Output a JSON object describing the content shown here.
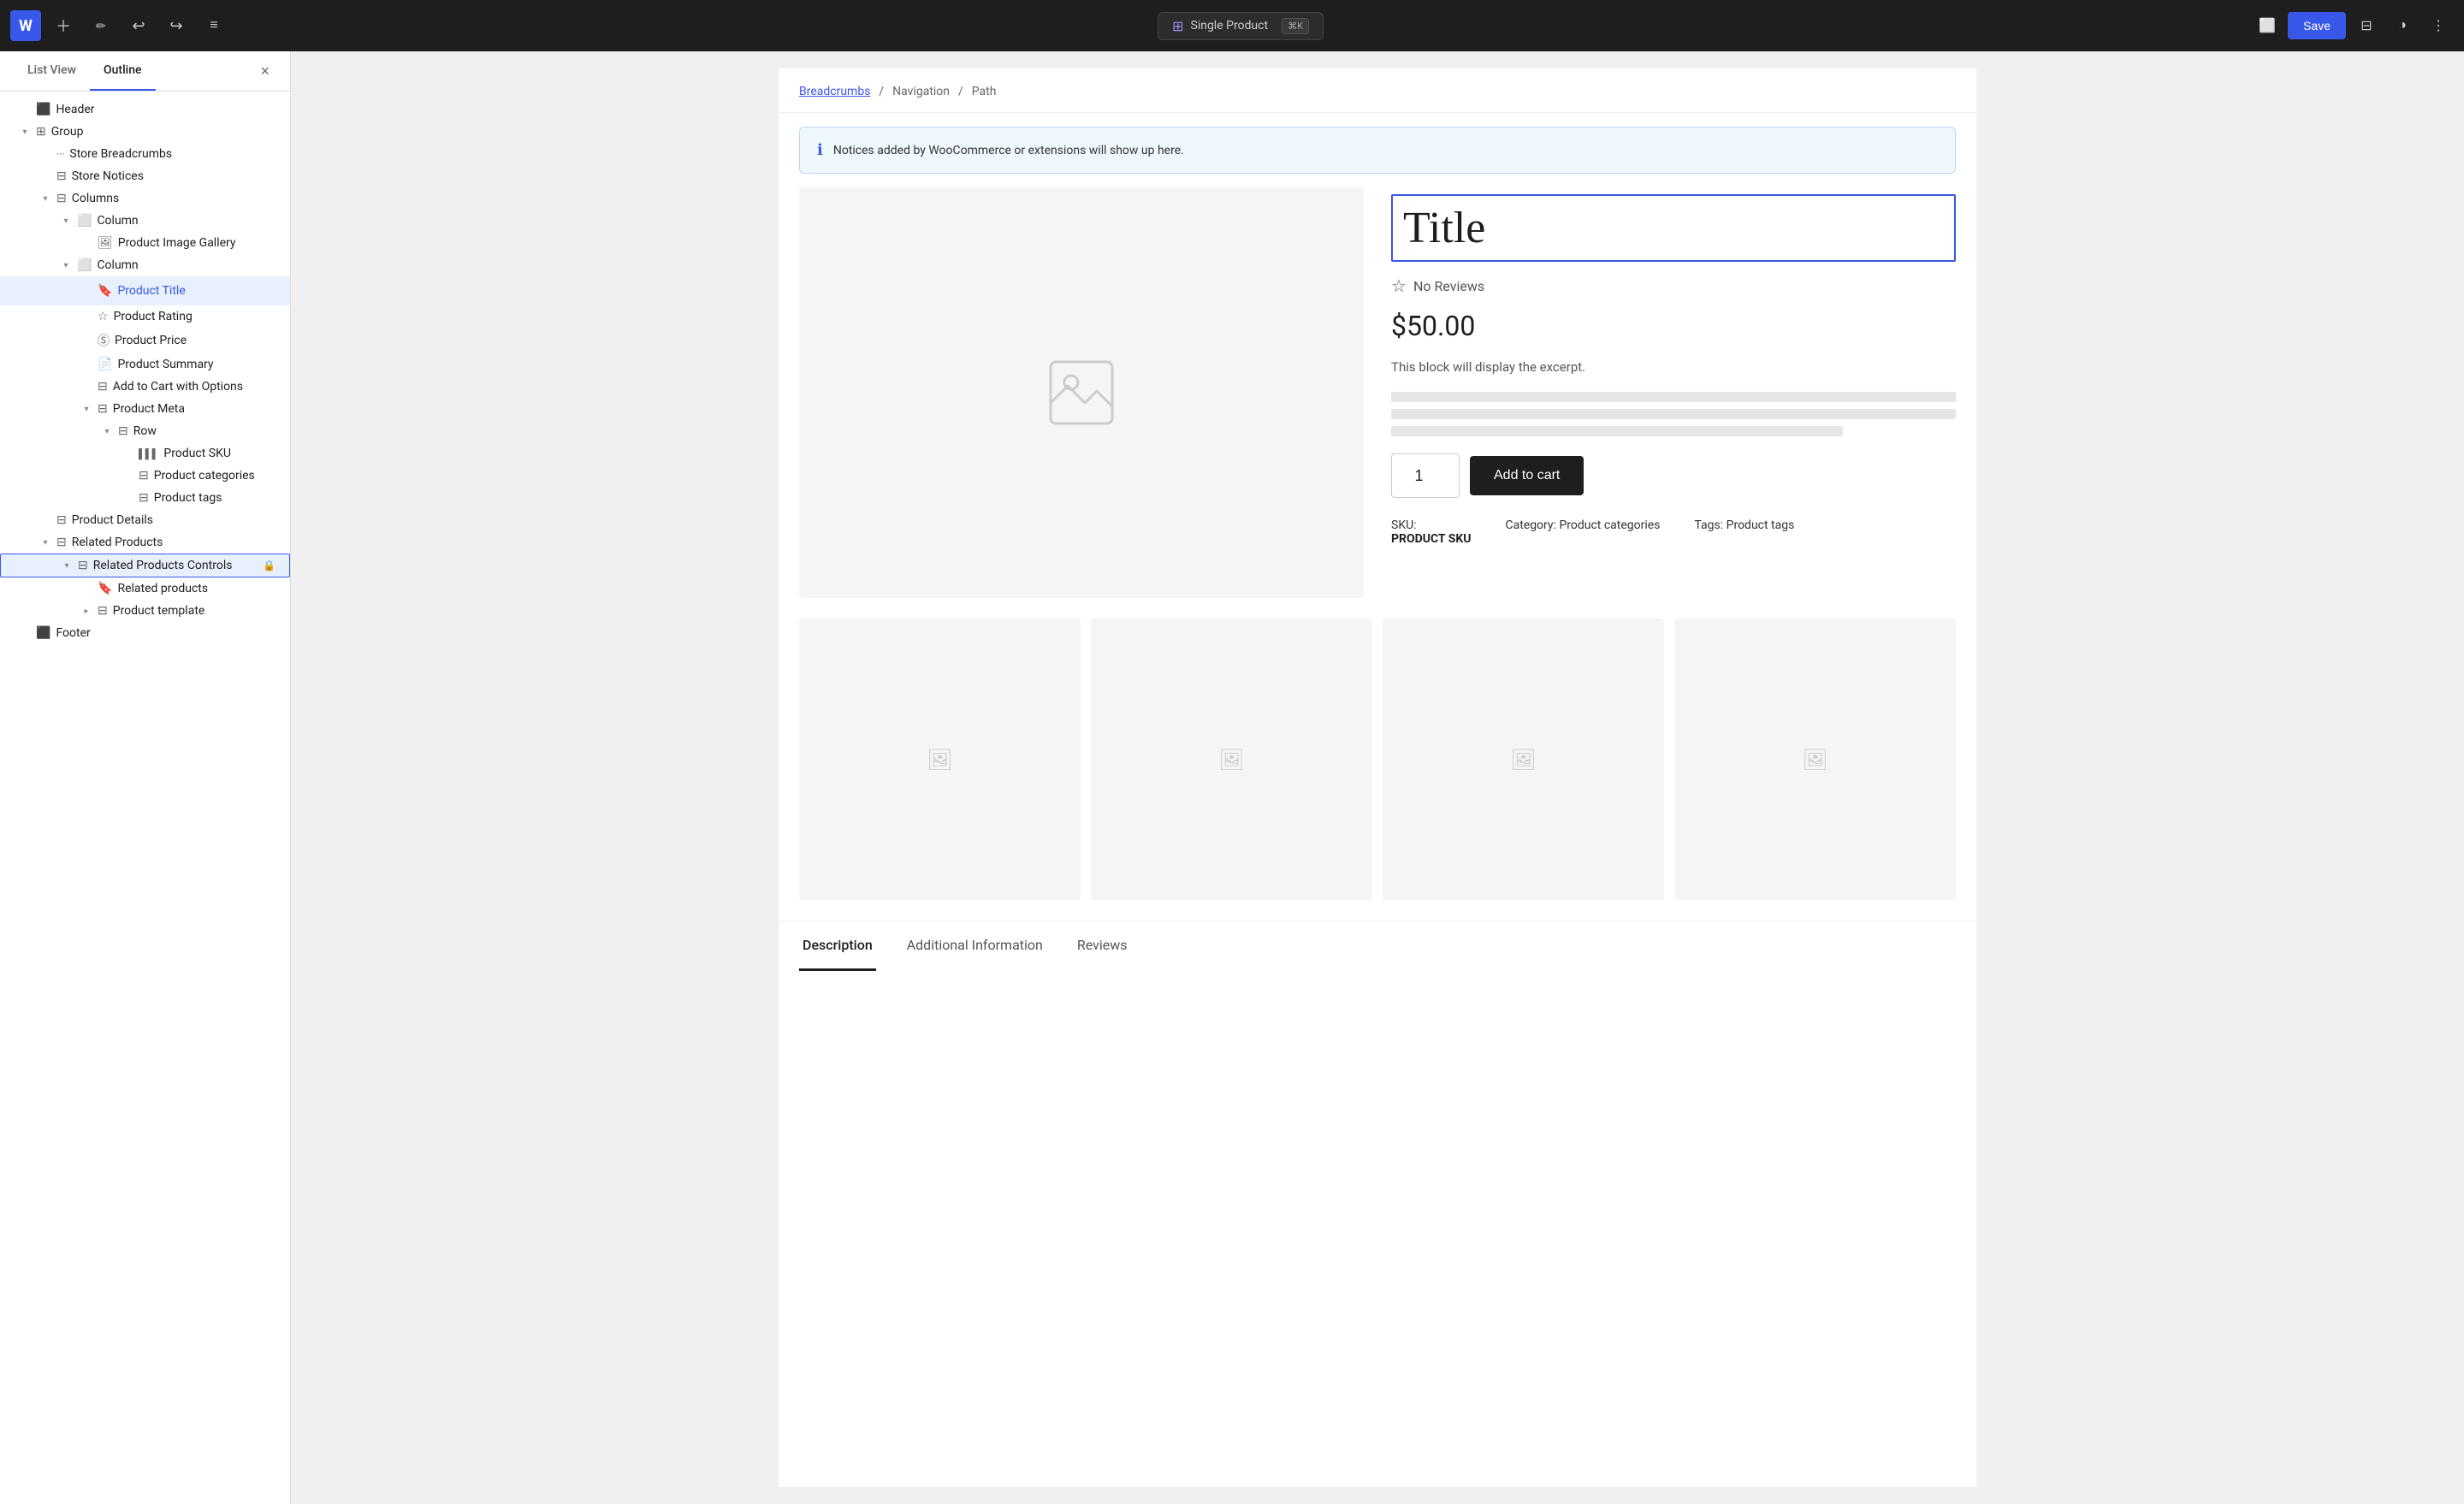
{
  "toolbar": {
    "wp_logo": "W",
    "add_label": "+",
    "edit_label": "✏",
    "undo_label": "↩",
    "redo_label": "↪",
    "list_view_label": "≡",
    "save_label": "Save",
    "template_name": "Single Product",
    "shortcut": "⌘K",
    "responsive_icon": "□",
    "style_icon": "◑",
    "more_icon": "⋮"
  },
  "sidebar": {
    "tab_list_view": "List View",
    "tab_outline": "Outline",
    "close_label": "×",
    "items": [
      {
        "id": "header",
        "label": "Header",
        "icon": "purple-block",
        "depth": 0,
        "toggle": ""
      },
      {
        "id": "group",
        "label": "Group",
        "icon": "grid",
        "depth": 0,
        "toggle": "▾"
      },
      {
        "id": "store-breadcrumbs",
        "label": "Store Breadcrumbs",
        "icon": "dots",
        "depth": 1,
        "toggle": ""
      },
      {
        "id": "store-notices",
        "label": "Store Notices",
        "icon": "table",
        "depth": 1,
        "toggle": ""
      },
      {
        "id": "columns",
        "label": "Columns",
        "icon": "columns",
        "depth": 1,
        "toggle": "▾"
      },
      {
        "id": "column-1",
        "label": "Column",
        "icon": "column",
        "depth": 2,
        "toggle": "▾"
      },
      {
        "id": "product-image-gallery",
        "label": "Product Image Gallery",
        "icon": "image",
        "depth": 3,
        "toggle": ""
      },
      {
        "id": "column-2",
        "label": "Column",
        "icon": "column",
        "depth": 2,
        "toggle": "▾"
      },
      {
        "id": "product-title",
        "label": "Product Title",
        "icon": "bookmark-blue",
        "depth": 3,
        "toggle": "",
        "selected": true
      },
      {
        "id": "product-rating",
        "label": "Product Rating",
        "icon": "star",
        "depth": 3,
        "toggle": ""
      },
      {
        "id": "product-price",
        "label": "Product Price",
        "icon": "circle-dollar",
        "depth": 3,
        "toggle": ""
      },
      {
        "id": "product-summary",
        "label": "Product Summary",
        "icon": "doc",
        "depth": 3,
        "toggle": ""
      },
      {
        "id": "add-to-cart",
        "label": "Add to Cart with Options",
        "icon": "cart",
        "depth": 3,
        "toggle": ""
      },
      {
        "id": "product-meta",
        "label": "Product Meta",
        "icon": "table",
        "depth": 3,
        "toggle": "▾"
      },
      {
        "id": "row",
        "label": "Row",
        "icon": "row",
        "depth": 4,
        "toggle": "▾"
      },
      {
        "id": "product-sku",
        "label": "Product SKU",
        "icon": "barcode",
        "depth": 5,
        "toggle": ""
      },
      {
        "id": "product-categories",
        "label": "Product categories",
        "icon": "categories",
        "depth": 5,
        "toggle": ""
      },
      {
        "id": "product-tags",
        "label": "Product tags",
        "icon": "tags",
        "depth": 5,
        "toggle": ""
      },
      {
        "id": "product-details",
        "label": "Product Details",
        "icon": "table",
        "depth": 1,
        "toggle": ""
      },
      {
        "id": "related-products",
        "label": "Related Products",
        "icon": "table",
        "depth": 1,
        "toggle": "▾"
      },
      {
        "id": "related-products-controls",
        "label": "Related Products Controls",
        "icon": "table",
        "depth": 2,
        "toggle": "▾",
        "locked": true,
        "active_selected": true
      },
      {
        "id": "related-products-list",
        "label": "Related products",
        "icon": "bookmark",
        "depth": 3,
        "toggle": ""
      },
      {
        "id": "product-template",
        "label": "Product template",
        "icon": "table",
        "depth": 3,
        "toggle": "▸"
      },
      {
        "id": "footer",
        "label": "Footer",
        "icon": "purple-block",
        "depth": 0,
        "toggle": ""
      }
    ]
  },
  "breadcrumb": {
    "link_text": "Breadcrumbs",
    "sep1": "/",
    "part2": "Navigation",
    "sep2": "/",
    "part3": "Path"
  },
  "notice": {
    "text": "Notices added by WooCommerce or extensions will show up here."
  },
  "product": {
    "title": "Title",
    "rating_text": "No Reviews",
    "price": "$50.00",
    "excerpt": "This block will display the excerpt.",
    "qty_value": "1",
    "add_to_cart_label": "Add to cart",
    "meta": {
      "sku_label": "SKU:",
      "sku_value": "PRODUCT SKU",
      "category_label": "Category:",
      "category_value": "Product categories",
      "tags_label": "Tags:",
      "tags_value": "Product tags"
    }
  },
  "tabs": [
    {
      "id": "description",
      "label": "Description",
      "active": true
    },
    {
      "id": "additional-info",
      "label": "Additional Information",
      "active": false
    },
    {
      "id": "reviews",
      "label": "Reviews",
      "active": false
    }
  ]
}
